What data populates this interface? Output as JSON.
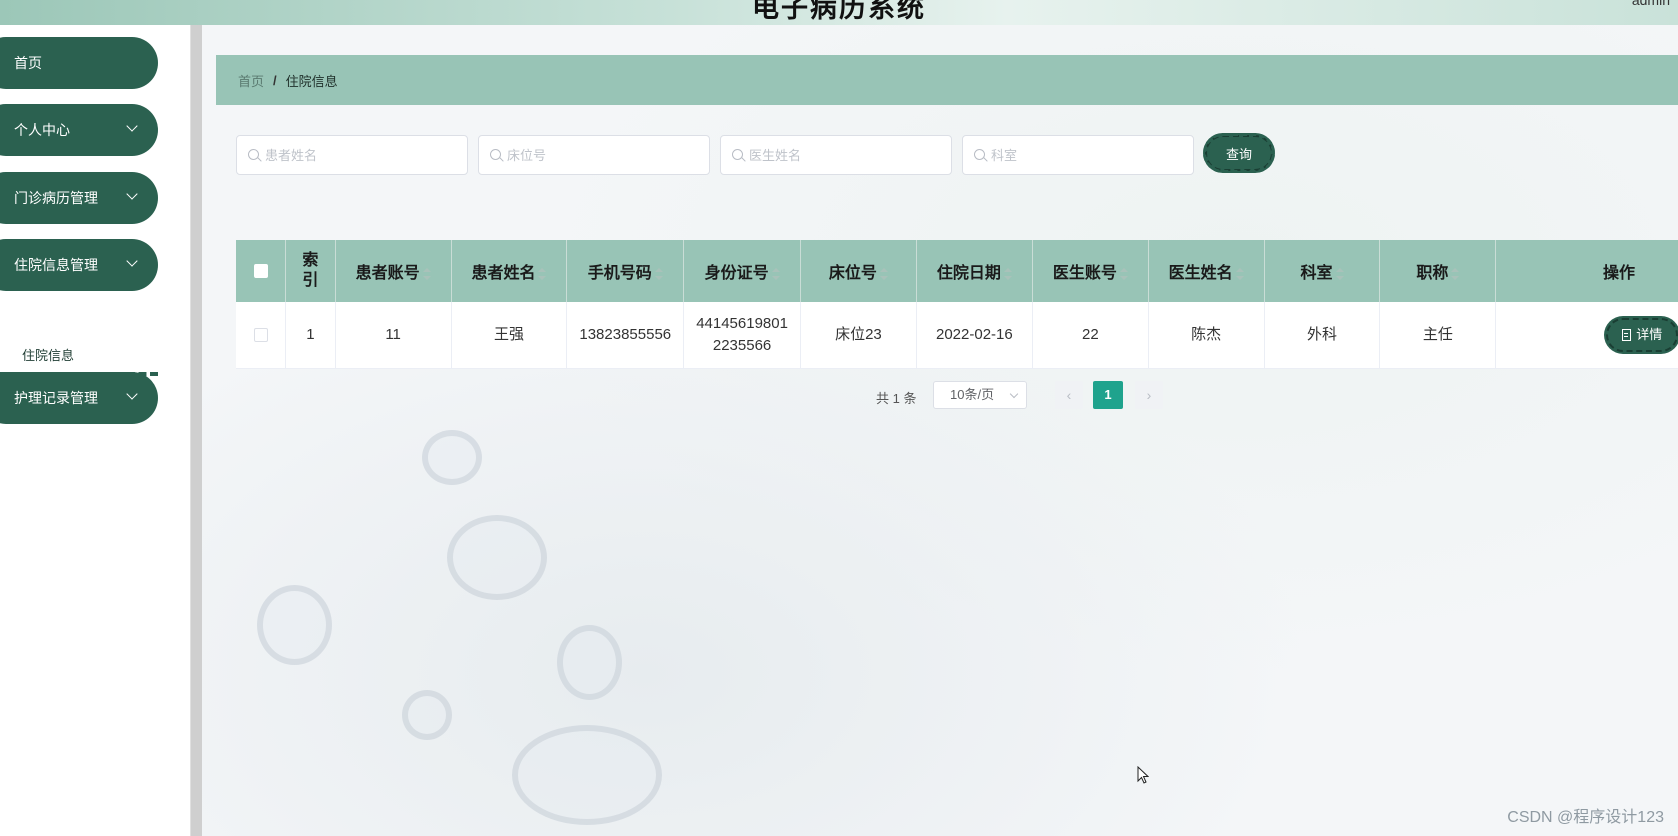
{
  "header": {
    "title": "电子病历系统",
    "user_text": "admin"
  },
  "sidebar": {
    "items": [
      {
        "label": "首页",
        "has_chevron": false
      },
      {
        "label": "个人中心",
        "has_chevron": true
      },
      {
        "label": "门诊病历管理",
        "has_chevron": true
      },
      {
        "label": "住院信息管理",
        "has_chevron": true
      },
      {
        "label": "护理记录管理",
        "has_chevron": true
      }
    ],
    "submenu_active": "住院信息"
  },
  "breadcrumb": {
    "home": "首页",
    "separator": "/",
    "current": "住院信息"
  },
  "search": {
    "patient_name_placeholder": "患者姓名",
    "bed_placeholder": "床位号",
    "doctor_name_placeholder": "医生姓名",
    "department_placeholder": "科室",
    "query_label": "查询"
  },
  "table": {
    "headers": [
      "索引",
      "患者账号",
      "患者姓名",
      "手机号码",
      "身份证号",
      "床位号",
      "住院日期",
      "医生账号",
      "医生姓名",
      "科室",
      "职称",
      "操作"
    ],
    "rows": [
      {
        "index": "1",
        "patient_account": "11",
        "patient_name": "王强",
        "phone": "13823855556",
        "id_card": "441456198012235566",
        "bed": "床位23",
        "admission_date": "2022-02-16",
        "doctor_account": "22",
        "doctor_name": "陈杰",
        "department": "外科",
        "title": "主任",
        "action_label": "详情"
      }
    ]
  },
  "pagination": {
    "total_text": "共 1 条",
    "page_size": "10条/页",
    "current_page": "1",
    "prev_symbol": "‹",
    "next_symbol": "›"
  },
  "watermark": "CSDN @程序设计123",
  "colors": {
    "primary": "#2b6150",
    "header_bg": "#98c4b6",
    "page_active": "#1fa38d"
  }
}
